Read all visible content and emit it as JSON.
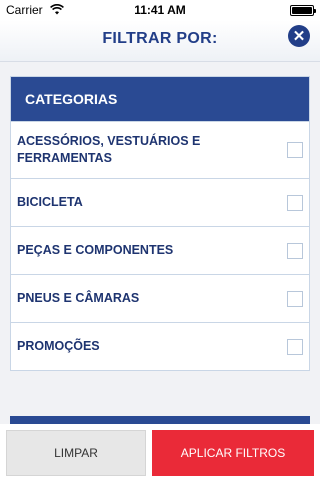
{
  "status_bar": {
    "carrier": "Carrier",
    "time": "11:41 AM",
    "wifi_icon": "wifi-icon",
    "battery_icon": "battery-icon"
  },
  "header": {
    "title": "FILTRAR POR:",
    "close_icon": "close-icon",
    "close_glyph": "✕",
    "accent_color": "#223e88"
  },
  "filter_panel": {
    "title": "CATEGORIAS",
    "items": [
      {
        "label": "ACESSÓRIOS, VESTUÁRIOS E FERRAMENTAS",
        "checked": false
      },
      {
        "label": "BICICLETA",
        "checked": false
      },
      {
        "label": "PEÇAS E COMPONENTES",
        "checked": false
      },
      {
        "label": "PNEUS E CÂMARAS",
        "checked": false
      },
      {
        "label": "PROMOÇÕES",
        "checked": false
      }
    ]
  },
  "actions": {
    "clear_label": "LIMPAR",
    "apply_label": "APLICAR FILTROS",
    "apply_color": "#ea2a38"
  }
}
